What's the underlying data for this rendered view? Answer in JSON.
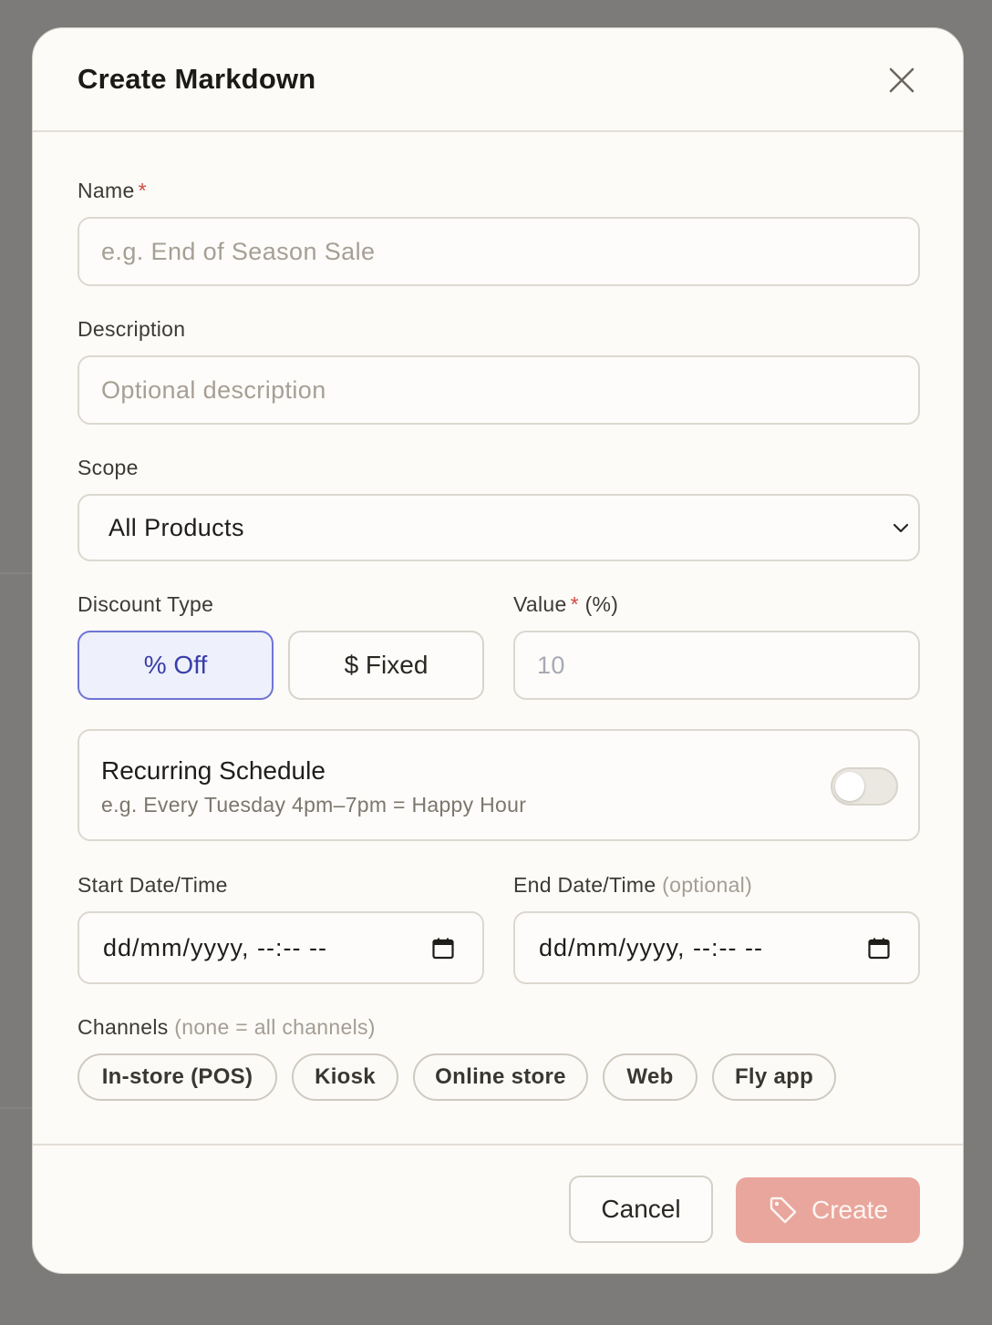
{
  "modal": {
    "title": "Create Markdown"
  },
  "form": {
    "name": {
      "label": "Name",
      "required_mark": "*",
      "placeholder": "e.g. End of Season Sale"
    },
    "description": {
      "label": "Description",
      "placeholder": "Optional description"
    },
    "scope": {
      "label": "Scope",
      "selected": "All Products"
    },
    "discount_type": {
      "label": "Discount Type",
      "options": [
        "% Off",
        "$ Fixed"
      ],
      "selected": "% Off"
    },
    "value": {
      "label": "Value",
      "required_mark": "*",
      "unit": "(%)",
      "placeholder": "10"
    },
    "recurring": {
      "title": "Recurring Schedule",
      "subtitle": "e.g. Every Tuesday 4pm–7pm = Happy Hour",
      "enabled": false
    },
    "start": {
      "label": "Start Date/Time",
      "value": "dd/mm/yyyy, --:-- --"
    },
    "end": {
      "label": "End Date/Time",
      "hint": "(optional)",
      "value": "dd/mm/yyyy, --:-- --"
    },
    "channels": {
      "label": "Channels",
      "hint": "(none = all channels)",
      "items": [
        "In-store (POS)",
        "Kiosk",
        "Online store",
        "Web",
        "Fly app"
      ]
    }
  },
  "footer": {
    "cancel_label": "Cancel",
    "create_label": "Create"
  },
  "colors": {
    "accent": "#6f74d4",
    "required": "#d24b3d",
    "create_button": "#e9a69c",
    "backdrop": "#7c7b79"
  },
  "icons": {
    "close": "close-icon",
    "chevron": "chevron-down-icon",
    "calendar": "calendar-icon",
    "tag": "tag-icon"
  }
}
